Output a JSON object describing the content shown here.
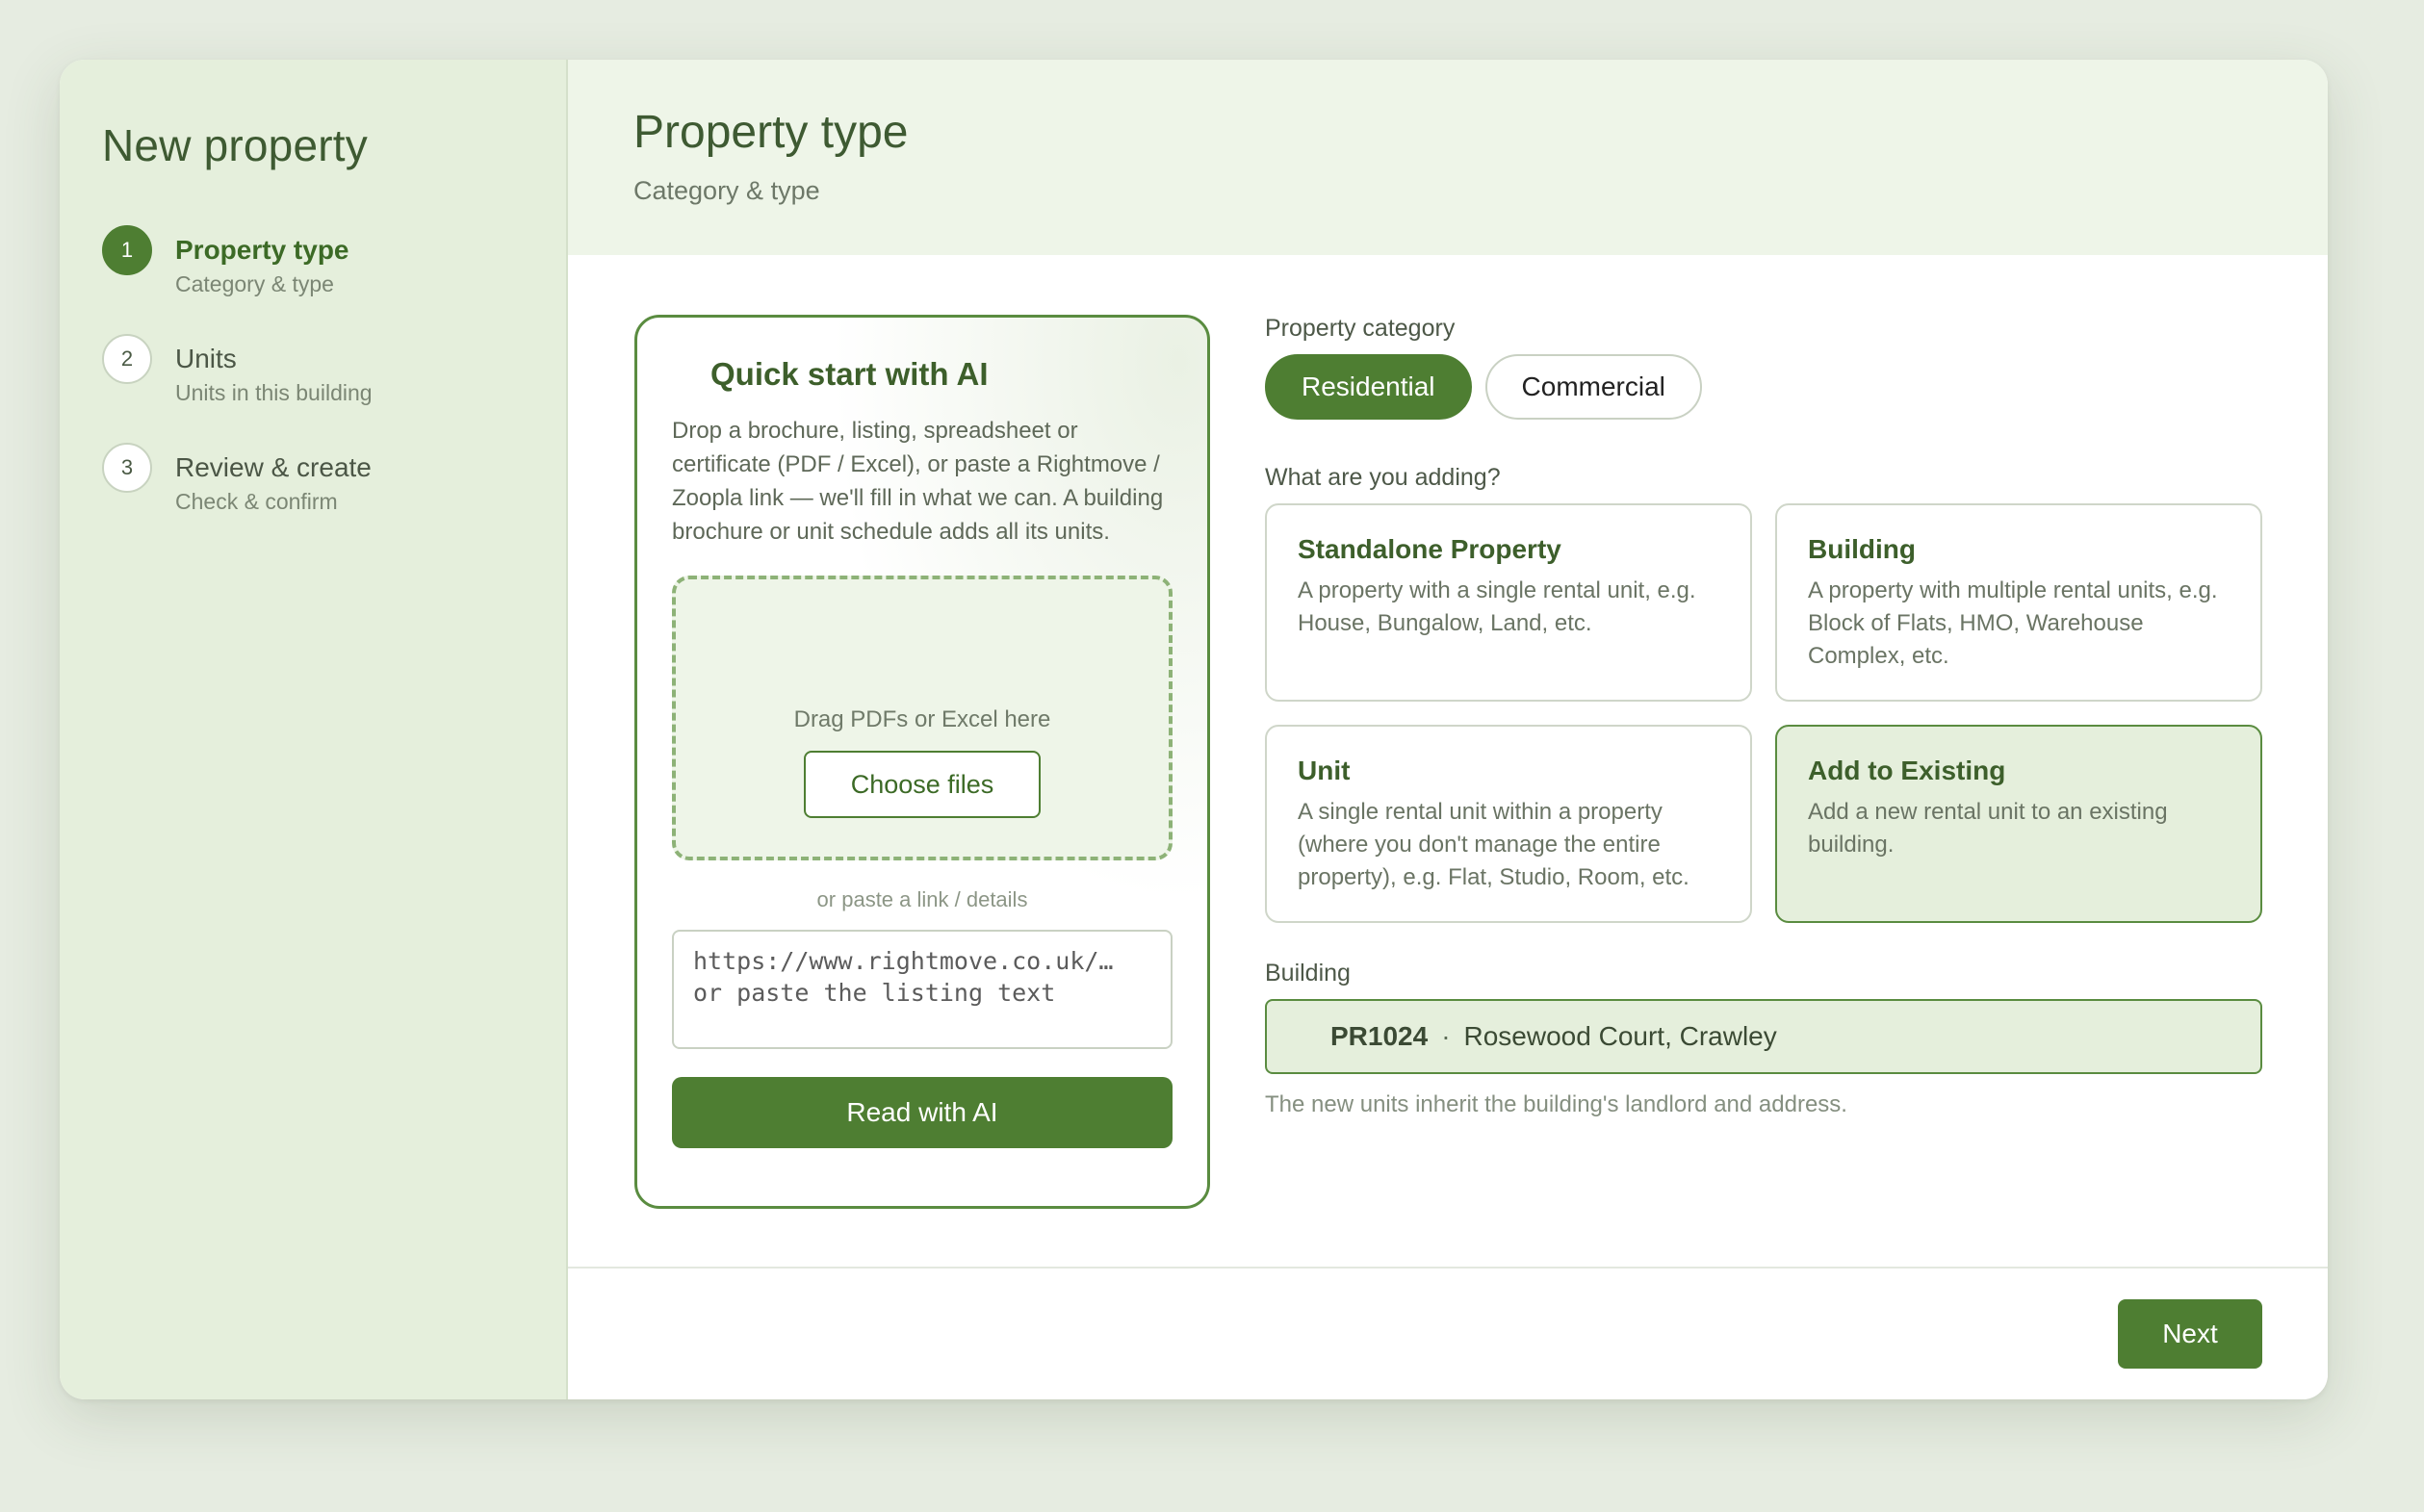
{
  "sidebar": {
    "title": "New property",
    "steps": [
      {
        "number": "1",
        "title": "Property type",
        "subtitle": "Category & type"
      },
      {
        "number": "2",
        "title": "Units",
        "subtitle": "Units in this building"
      },
      {
        "number": "3",
        "title": "Review & create",
        "subtitle": "Check & confirm"
      }
    ]
  },
  "header": {
    "title": "Property type",
    "subtitle": "Category & type"
  },
  "ai_card": {
    "title": "Quick start with AI",
    "description": "Drop a brochure, listing, spreadsheet or certificate (PDF / Excel), or paste a Rightmove / Zoopla link — we'll fill in what we can. A building brochure or unit schedule adds all its units.",
    "drop_text": "Drag PDFs or Excel here",
    "choose_button": "Choose files",
    "or_text": "or paste a link / details",
    "link_placeholder": "https://www.rightmove.co.uk/… or paste the listing text",
    "read_button": "Read with AI"
  },
  "form": {
    "category_label": "Property category",
    "categories": [
      {
        "label": "Residential",
        "selected": true
      },
      {
        "label": "Commercial",
        "selected": false
      }
    ],
    "adding_label": "What are you adding?",
    "options": [
      {
        "title": "Standalone Property",
        "description": "A property with a single rental unit, e.g. House, Bungalow, Land, etc.",
        "selected": false
      },
      {
        "title": "Building",
        "description": "A property with multiple rental units, e.g. Block of Flats, HMO, Warehouse Complex, etc.",
        "selected": false
      },
      {
        "title": "Unit",
        "description": "A single rental unit within a property (where you don't manage the entire property), e.g. Flat, Studio, Room, etc.",
        "selected": false
      },
      {
        "title": "Add to Existing",
        "description": "Add a new rental unit to an existing building.",
        "selected": true
      }
    ],
    "building_label": "Building",
    "building_code": "PR1024",
    "building_separator": "·",
    "building_name": "Rosewood Court, Crawley",
    "hint": "The new units inherit the building's landlord and address."
  },
  "footer": {
    "next_button": "Next"
  },
  "colors": {
    "accent": "#4e7e32",
    "sidebar_bg": "#e5efdc",
    "header_bg": "#eef5e8",
    "page_bg": "#e6ece1"
  }
}
